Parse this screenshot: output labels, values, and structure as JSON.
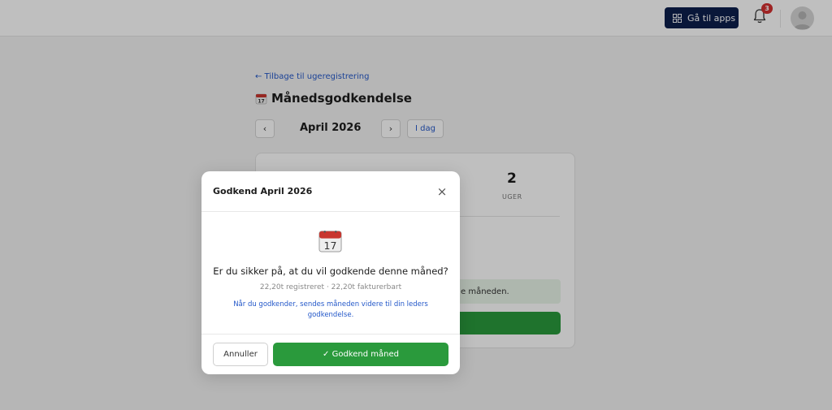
{
  "topbar": {
    "apps_label": "Gå til apps",
    "apps_icon": "grid-icon",
    "notification_icon": "bell-icon",
    "notification_count": "3",
    "avatar_icon": "user-avatar-icon"
  },
  "page": {
    "back_link": "← Tilbage til ugeregistrering",
    "title_icon": "calendar-icon",
    "title": "Månedsgodkendelse",
    "prev_label": "‹",
    "month": "April 2026",
    "next_label": "›",
    "today_label": "I dag"
  },
  "card": {
    "stat_value": "2",
    "stat_label": "UGER",
    "info_text": "e måneden."
  },
  "modal": {
    "title": "Godkend April 2026",
    "close_label": "×",
    "icon": "calendar-icon",
    "question": "Er du sikker på, at du vil godkende denne måned?",
    "summary": "22,20t registreret · 22,20t fakturerbart",
    "note": "Når du godkender, sendes måneden videre til din leders godkendelse.",
    "cancel_label": "Annuller",
    "confirm_label": "✓ Godkend måned"
  },
  "colors": {
    "navy": "#0c1f4d",
    "green": "#2a9a3c",
    "link_blue": "#2458c9",
    "badge_red": "#d32f2f"
  }
}
